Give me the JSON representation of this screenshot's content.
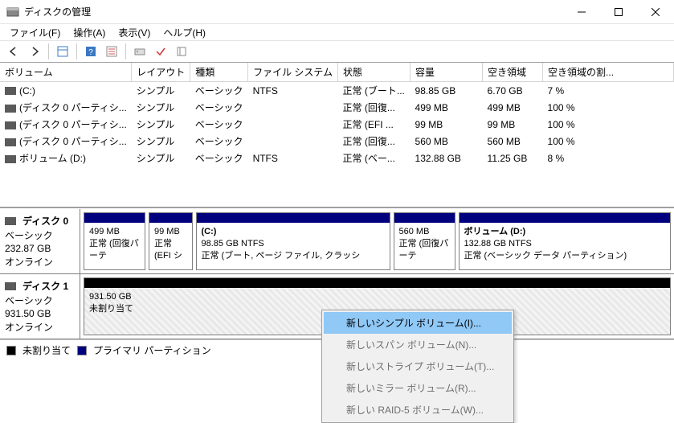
{
  "window": {
    "title": "ディスクの管理"
  },
  "menu": {
    "file": "ファイル(F)",
    "action": "操作(A)",
    "view": "表示(V)",
    "help": "ヘルプ(H)"
  },
  "columns": [
    "ボリューム",
    "レイアウト",
    "種類",
    "ファイル システム",
    "状態",
    "容量",
    "空き領域",
    "空き領域の割..."
  ],
  "volumes": [
    {
      "name": "(C:)",
      "layout": "シンプル",
      "type": "ベーシック",
      "fs": "NTFS",
      "status": "正常 (ブート...",
      "cap": "98.85 GB",
      "free": "6.70 GB",
      "pct": "7 %"
    },
    {
      "name": "(ディスク 0 パーティシ...",
      "layout": "シンプル",
      "type": "ベーシック",
      "fs": "",
      "status": "正常 (回復...",
      "cap": "499 MB",
      "free": "499 MB",
      "pct": "100 %"
    },
    {
      "name": "(ディスク 0 パーティシ...",
      "layout": "シンプル",
      "type": "ベーシック",
      "fs": "",
      "status": "正常 (EFI ...",
      "cap": "99 MB",
      "free": "99 MB",
      "pct": "100 %"
    },
    {
      "name": "(ディスク 0 パーティシ...",
      "layout": "シンプル",
      "type": "ベーシック",
      "fs": "",
      "status": "正常 (回復...",
      "cap": "560 MB",
      "free": "560 MB",
      "pct": "100 %"
    },
    {
      "name": "ボリューム (D:)",
      "layout": "シンプル",
      "type": "ベーシック",
      "fs": "NTFS",
      "status": "正常 (ベー...",
      "cap": "132.88 GB",
      "free": "11.25 GB",
      "pct": "8 %"
    }
  ],
  "disk0": {
    "label": "ディスク 0",
    "type": "ベーシック",
    "size": "232.87 GB",
    "status": "オンライン",
    "parts": [
      {
        "title": "",
        "line1": "499 MB",
        "line2": "正常 (回復パーテ"
      },
      {
        "title": "",
        "line1": "99 MB",
        "line2": "正常 (EFI シ"
      },
      {
        "title": "(C:)",
        "line1": "98.85 GB NTFS",
        "line2": "正常 (ブート, ページ ファイル, クラッシ"
      },
      {
        "title": "",
        "line1": "560 MB",
        "line2": "正常 (回復パーテ"
      },
      {
        "title": "ボリューム  (D:)",
        "line1": "132.88 GB NTFS",
        "line2": "正常 (ベーシック データ パーティション)"
      }
    ]
  },
  "disk1": {
    "label": "ディスク 1",
    "type": "ベーシック",
    "size": "931.50 GB",
    "status": "オンライン",
    "unalloc": {
      "size": "931.50 GB",
      "label": "未割り当て"
    }
  },
  "legend": {
    "unalloc": "未割り当て",
    "primary": "プライマリ パーティション"
  },
  "contextMenu": {
    "items": [
      "新しいシンプル ボリューム(I)...",
      "新しいスパン ボリューム(N)...",
      "新しいストライプ ボリューム(T)...",
      "新しいミラー ボリューム(R)...",
      "新しい RAID-5 ボリューム(W)..."
    ]
  }
}
